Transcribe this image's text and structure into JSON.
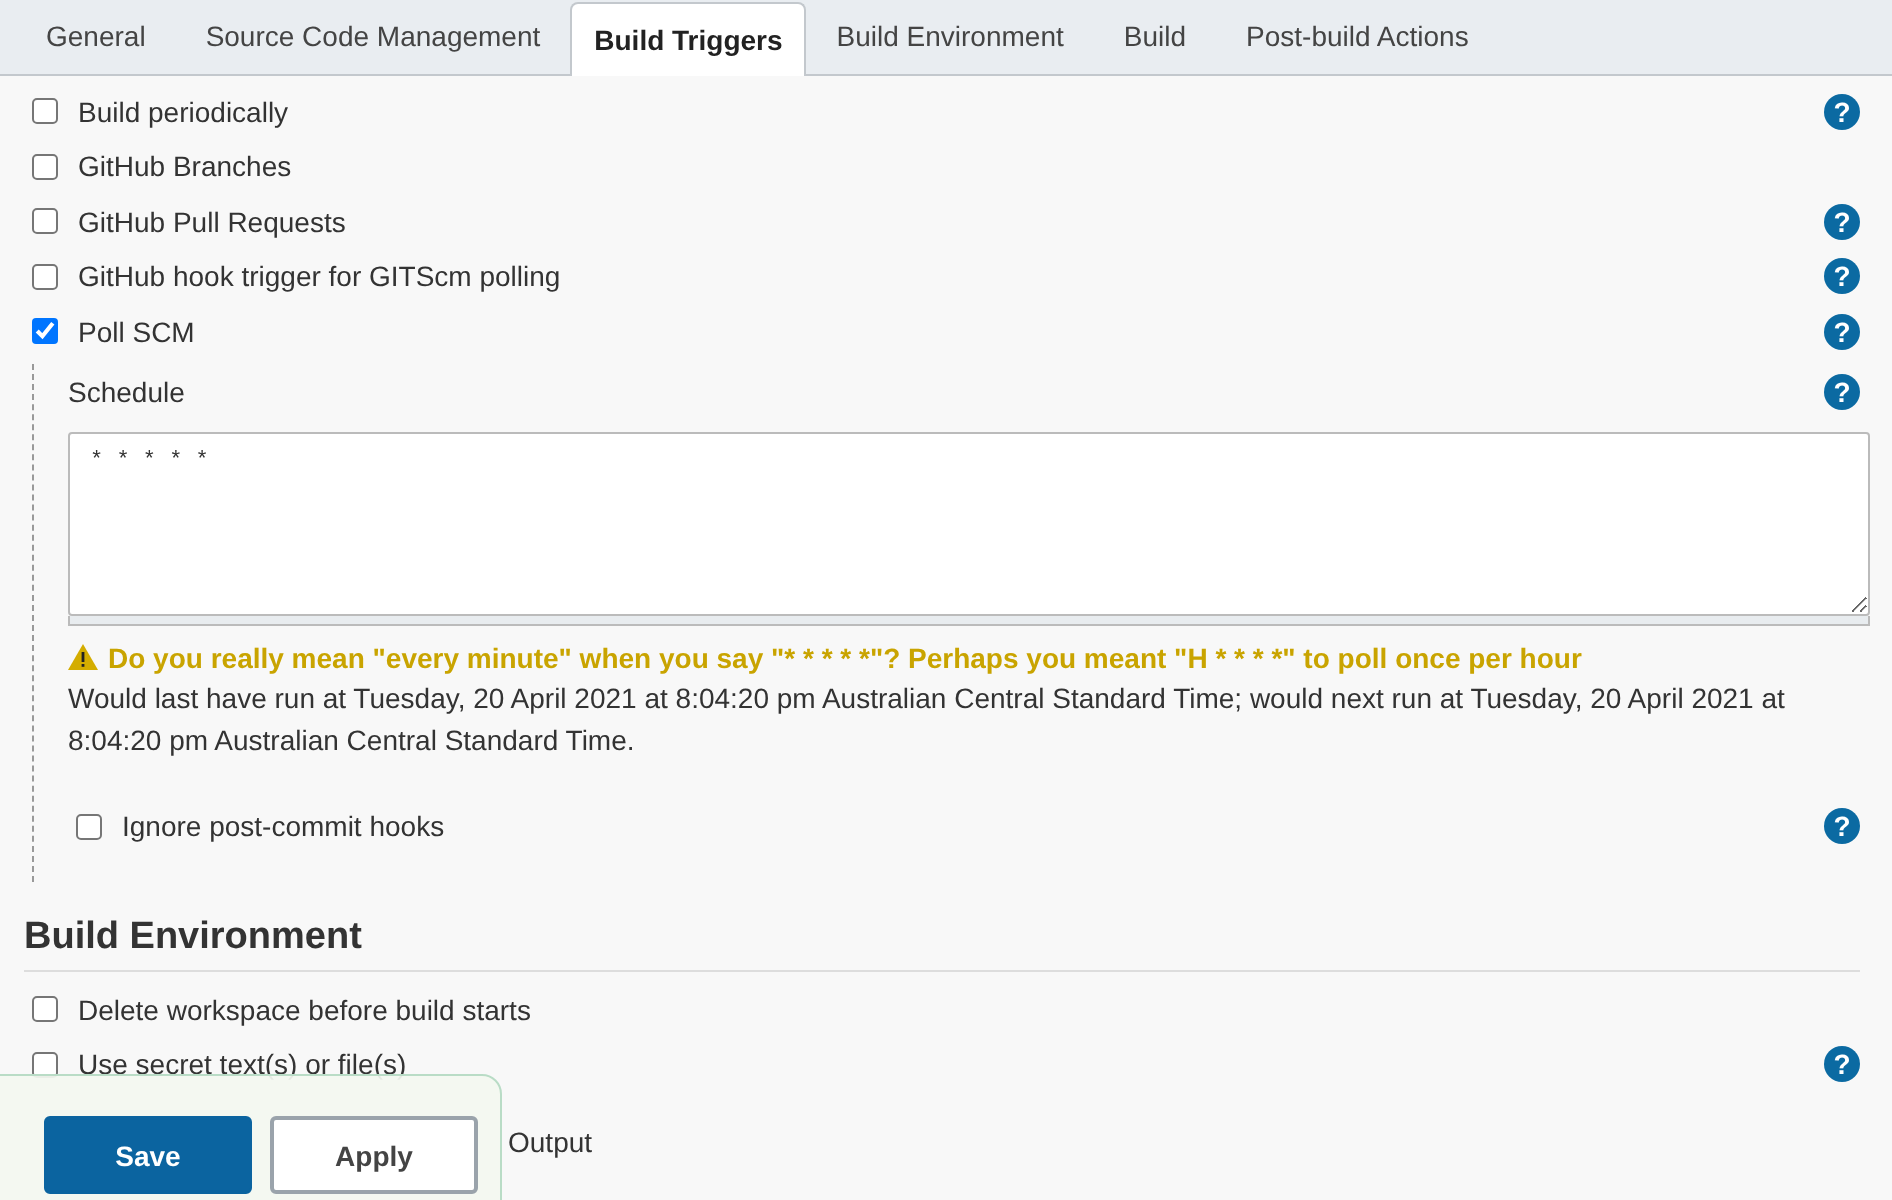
{
  "tabs": [
    {
      "label": "General",
      "selected": false
    },
    {
      "label": "Source Code Management",
      "selected": false
    },
    {
      "label": "Build Triggers",
      "selected": true
    },
    {
      "label": "Build Environment",
      "selected": false
    },
    {
      "label": "Build",
      "selected": false
    },
    {
      "label": "Post-build Actions",
      "selected": false
    }
  ],
  "triggers": [
    {
      "label": "Build periodically",
      "checked": false,
      "help": "?"
    },
    {
      "label": "GitHub Branches",
      "checked": false
    },
    {
      "label": "GitHub Pull Requests",
      "checked": false,
      "help": "?"
    },
    {
      "label": "GitHub hook trigger for GITScm polling",
      "checked": false,
      "help": "?"
    },
    {
      "label": "Poll SCM",
      "checked": true,
      "help": "?"
    }
  ],
  "schedule": {
    "label": "Schedule",
    "help": "?",
    "value": "* * * * *",
    "warning": "Do you really mean \"every minute\" when you say \"* * * * *\"? Perhaps you meant \"H * * * *\" to poll once per hour",
    "info": "Would last have run at Tuesday, 20 April 2021 at 8:04:20 pm Australian Central Standard Time; would next run at Tuesday, 20 April 2021 at 8:04:20 pm Australian Central Standard Time.",
    "ignore": {
      "label": "Ignore post-commit hooks",
      "checked": false,
      "help": "?"
    }
  },
  "build_environment": {
    "title": "Build Environment",
    "options": [
      {
        "label": "Delete workspace before build starts",
        "checked": false
      },
      {
        "label": "Use secret text(s) or file(s)",
        "checked": false,
        "help": "?"
      }
    ],
    "partial_option": "Output"
  },
  "buttons": [
    {
      "label": "Save",
      "kind": "primary"
    },
    {
      "label": "Apply",
      "kind": "secondary"
    }
  ]
}
